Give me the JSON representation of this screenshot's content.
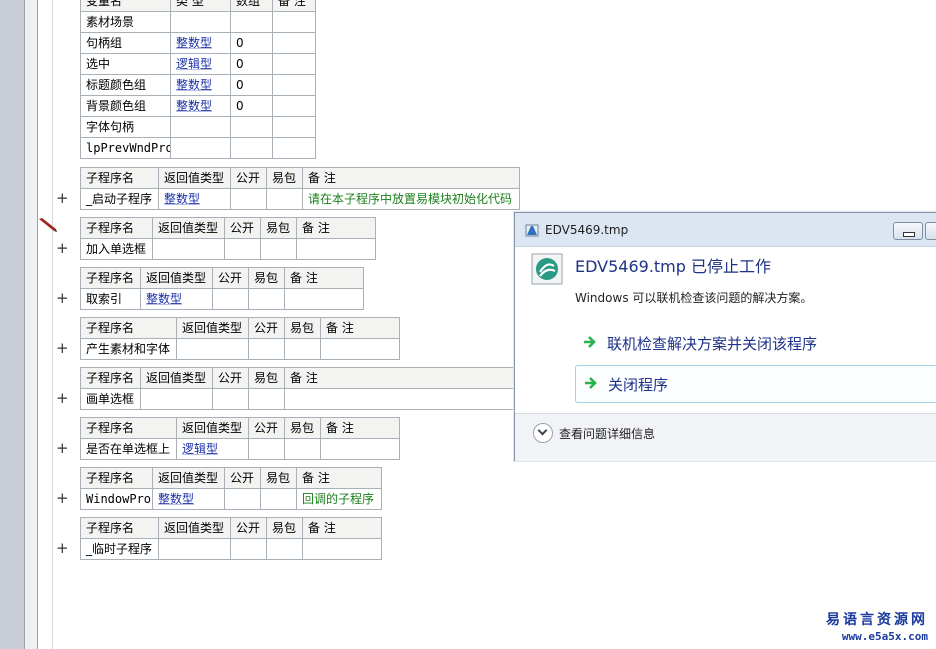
{
  "var_table": {
    "headers": [
      "变量名",
      "类 型",
      "数组",
      "备 注"
    ],
    "rows": [
      [
        "素材场景",
        "",
        "",
        ""
      ],
      [
        "句柄组",
        "整数型",
        "0",
        ""
      ],
      [
        "选中",
        "逻辑型",
        "0",
        ""
      ],
      [
        "标题颜色组",
        "整数型",
        "0",
        ""
      ],
      [
        "背景颜色组",
        "整数型",
        "0",
        ""
      ],
      [
        "字体句柄",
        "",
        "",
        ""
      ],
      [
        "lpPrevWndProc",
        "",
        "",
        ""
      ]
    ]
  },
  "sub_headers": [
    "子程序名",
    "返回值类型",
    "公开",
    "易包",
    "备 注"
  ],
  "subprograms": [
    {
      "name": "_启动子程序",
      "ret": "整数型",
      "public": "",
      "pkg": "",
      "note": "请在本子程序中放置易模块初始化代码"
    },
    {
      "name": "加入单选框",
      "ret": "",
      "public": "",
      "pkg": "",
      "note": ""
    },
    {
      "name": "取索引",
      "ret": "整数型",
      "public": "",
      "pkg": "",
      "note": ""
    },
    {
      "name": "产生素材和字体",
      "ret": "",
      "public": "",
      "pkg": "",
      "note": ""
    },
    {
      "name": "画单选框",
      "ret": "",
      "public": "",
      "pkg": "",
      "note": ""
    },
    {
      "name": "是否在单选框上",
      "ret": "逻辑型",
      "public": "",
      "pkg": "",
      "note": ""
    },
    {
      "name": "WindowProc",
      "ret": "整数型",
      "public": "",
      "pkg": "",
      "note": "回调的子程序"
    },
    {
      "name": "_临时子程序",
      "ret": "",
      "public": "",
      "pkg": "",
      "note": ""
    }
  ],
  "expand_symbol": "+",
  "dialog": {
    "title": "EDV5469.tmp",
    "headline": "EDV5469.tmp 已停止工作",
    "subtext": "Windows 可以联机检查该问题的解决方案。",
    "options": [
      "联机检查解决方案并关闭该程序",
      "关闭程序"
    ],
    "details": "查看问题详细信息"
  },
  "watermark": {
    "line1": "易语言资源网",
    "line2": "www.e5a5x.com"
  },
  "colors": {
    "type_blue": "#1a2fa8",
    "note_green": "#1b7f1b",
    "dialog_heading": "#1e3287",
    "option_arrow": "#2bb24c",
    "watermark": "#1b3a9e"
  }
}
